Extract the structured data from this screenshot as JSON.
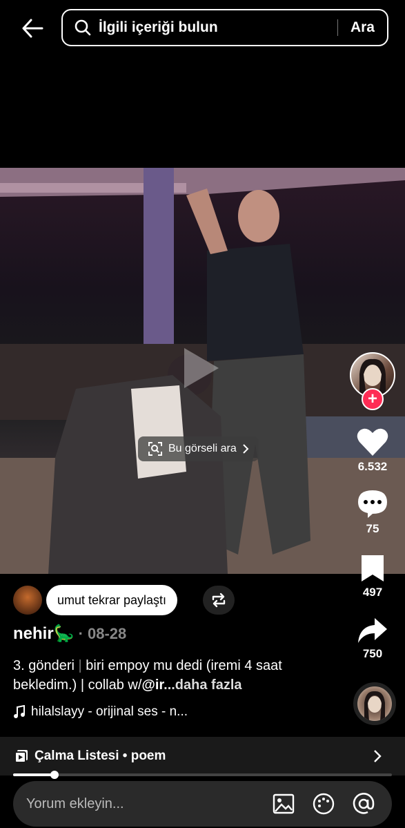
{
  "search": {
    "placeholder": "İlgili içeriği bulun",
    "button": "Ara"
  },
  "media": {
    "visual_search_label": "Bu görseli ara"
  },
  "actions": {
    "likes": "6.532",
    "comments": "75",
    "saves": "497",
    "shares": "750"
  },
  "repost": {
    "label": "umut tekrar paylaştı"
  },
  "post": {
    "username": "nehir🦕",
    "date": "· 08-28",
    "caption_start": "3. gönderi ",
    "caption_bar": "|",
    "caption_rest": " biri empoy mu dedi (iremi 4 saat bekledim.) | collab w/",
    "caption_mention": "@ir",
    "caption_more": "...daha fazla",
    "sound": "hilalslayy - orijinal ses - n..."
  },
  "playlist": {
    "label": "Çalma Listesi • poem",
    "progress": 0.11
  },
  "comment": {
    "placeholder": "Yorum ekleyin..."
  },
  "colors": {
    "accent": "#fe2c55",
    "background": "#000000"
  }
}
